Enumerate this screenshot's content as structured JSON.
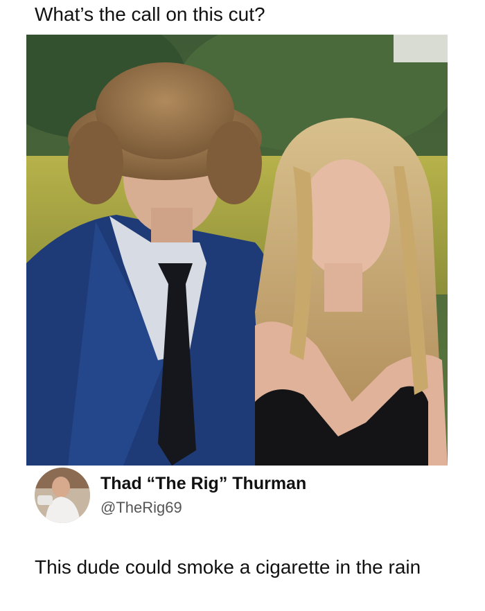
{
  "post": {
    "title": "What’s the call on this cut?",
    "photo_icon": "photo-image",
    "author": {
      "name": "Thad “The Rig” Thurman",
      "handle": "@TheRig69",
      "avatar_icon": "avatar-image"
    },
    "body": "This dude could smoke a cigarette in the rain"
  }
}
